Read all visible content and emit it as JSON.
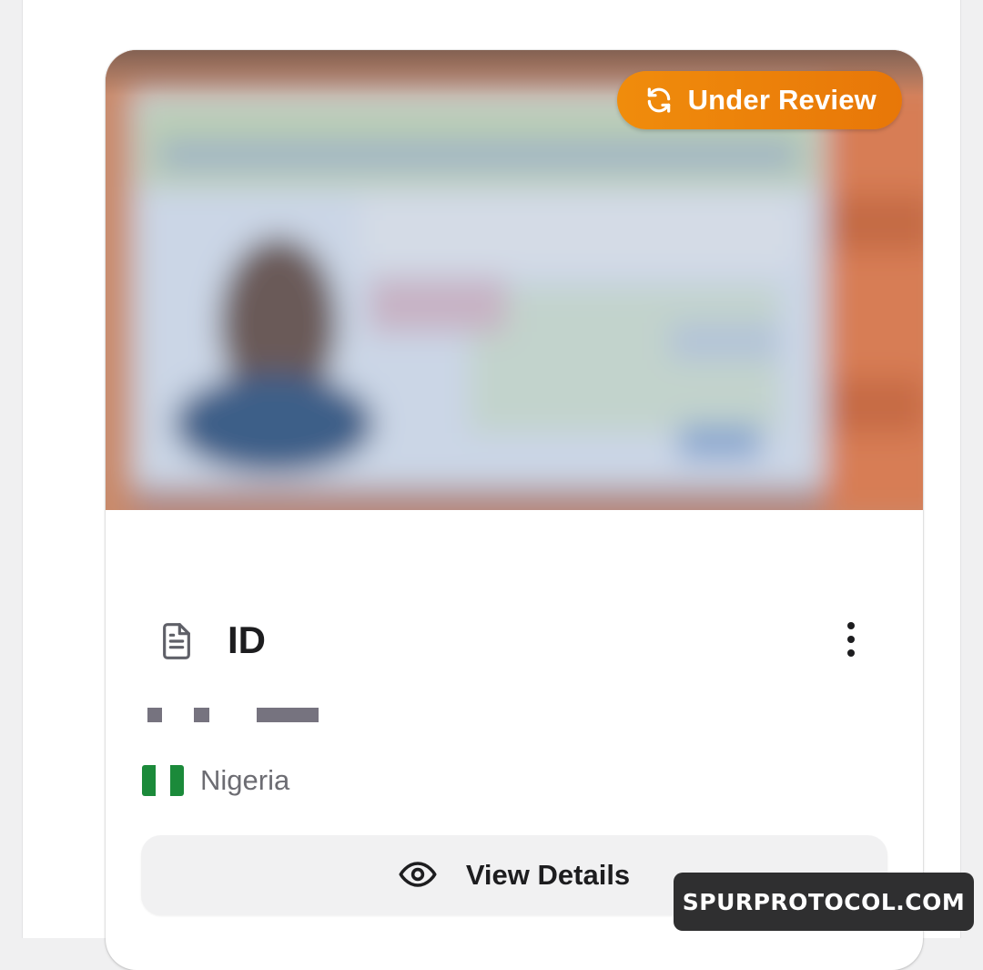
{
  "document_card": {
    "status_badge": {
      "label": "Under Review",
      "icon": "refresh-icon",
      "color": "#f08c0c"
    },
    "doc_icon": "document-icon",
    "title": "ID",
    "menu_icon": "more-vertical-icon",
    "country": {
      "flag": "nigeria-flag-icon",
      "name": "Nigeria"
    },
    "view_details": {
      "label": "View Details",
      "icon": "eye-icon"
    }
  },
  "watermark": {
    "text": "SPURPROTOCOL.COM"
  }
}
